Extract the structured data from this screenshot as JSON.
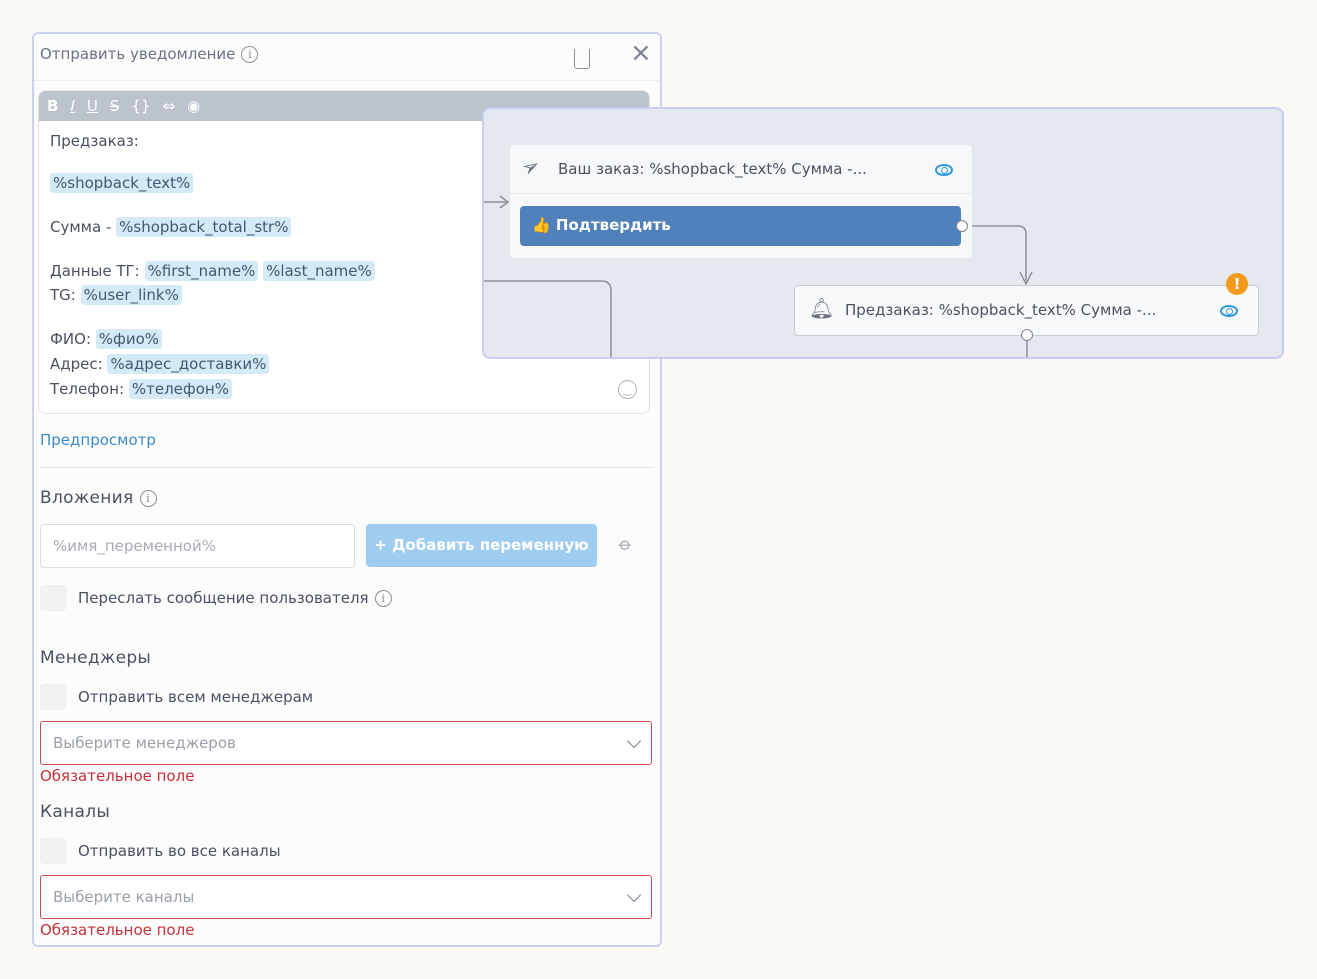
{
  "panel": {
    "title": "Отправить уведомление",
    "toolbar": [
      "B",
      "I",
      "U",
      "S",
      "{}",
      "⇔",
      "◉"
    ],
    "editor": {
      "l1": "Предзаказ:",
      "l2": "%shopback_text%",
      "l3a": "Сумма - ",
      "l3b": "%shopback_total_str%",
      "l4a": "Данные ТГ: ",
      "l4b": "%first_name%",
      "l4c": "%last_name%",
      "l5a": "TG: ",
      "l5b": "%user_link%",
      "l6a": "ФИО: ",
      "l6b": "%фио%",
      "l7a": "Адрес: ",
      "l7b": "%адрес_доставки%",
      "l8a": "Телефон: ",
      "l8b": "%телефон%"
    },
    "preview": "Предпросмотр",
    "attachments": {
      "title": "Вложения",
      "placeholder": "%имя_переменной%",
      "add": "+ Добавить переменную",
      "forward": "Переслать сообщение пользователя"
    },
    "managers": {
      "title": "Менеджеры",
      "all": "Отправить всем менеджерам",
      "placeholder": "Выберите менеджеров",
      "error": "Обязательное поле"
    },
    "channels": {
      "title": "Каналы",
      "all": "Отправить во все каналы",
      "placeholder": "Выберите каналы",
      "error": "Обязательное поле"
    }
  },
  "flow": {
    "node1": {
      "text": "Ваш заказ: %shopback_text% Сумма -...",
      "button": "Подтвердить"
    },
    "node2": {
      "text": "Предзаказ: %shopback_text% Сумма -...",
      "warning": "!"
    }
  }
}
